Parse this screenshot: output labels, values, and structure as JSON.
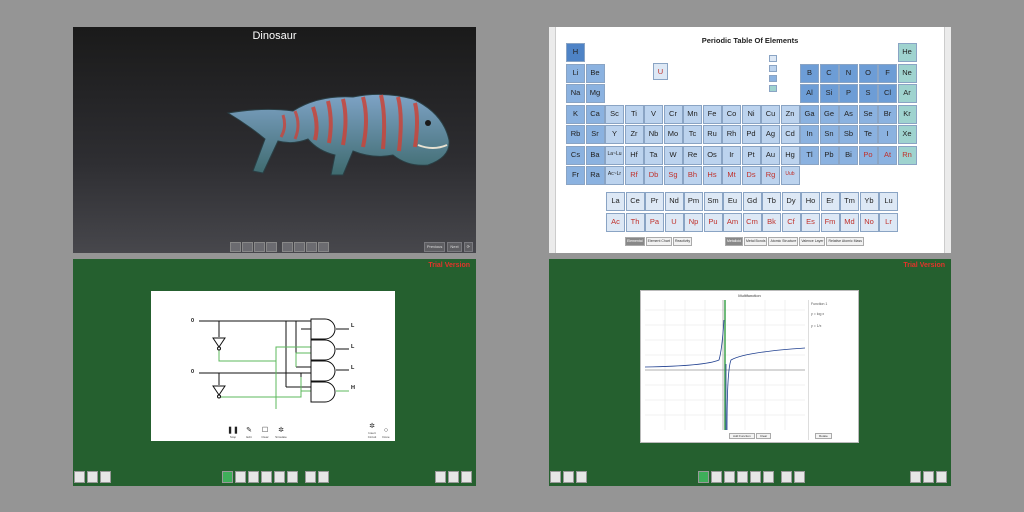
{
  "dinosaur": {
    "title": "Dinosaur",
    "toolbar_icons": [
      "pointer-icon",
      "pen-icon",
      "eraser-icon",
      "fill-icon",
      "move-icon",
      "rotate-icon",
      "zoom-icon",
      "settings-icon"
    ],
    "right_buttons": [
      "Previous",
      "Next"
    ]
  },
  "periodic_table": {
    "title": "Periodic Table Of Elements",
    "featured": "U",
    "main_rows": [
      [
        "H",
        "",
        "",
        "",
        "",
        "",
        "",
        "",
        "",
        "",
        "",
        "",
        "",
        "",
        "",
        "",
        "",
        "He"
      ],
      [
        "Li",
        "Be",
        "",
        "",
        "",
        "",
        "",
        "",
        "",
        "",
        "",
        "",
        "B",
        "C",
        "N",
        "O",
        "F",
        "Ne"
      ],
      [
        "Na",
        "Mg",
        "",
        "",
        "",
        "",
        "",
        "",
        "",
        "",
        "",
        "",
        "Al",
        "Si",
        "P",
        "S",
        "Cl",
        "Ar"
      ],
      [
        "K",
        "Ca",
        "Sc",
        "Ti",
        "V",
        "Cr",
        "Mn",
        "Fe",
        "Co",
        "Ni",
        "Cu",
        "Zn",
        "Ga",
        "Ge",
        "As",
        "Se",
        "Br",
        "Kr"
      ],
      [
        "Rb",
        "Sr",
        "Y",
        "Zr",
        "Nb",
        "Mo",
        "Tc",
        "Ru",
        "Rh",
        "Pd",
        "Ag",
        "Cd",
        "In",
        "Sn",
        "Sb",
        "Te",
        "I",
        "Xe"
      ],
      [
        "Cs",
        "Ba",
        "La~Lu",
        "Hf",
        "Ta",
        "W",
        "Re",
        "Os",
        "Ir",
        "Pt",
        "Au",
        "Hg",
        "Tl",
        "Pb",
        "Bi",
        "Po",
        "At",
        "Rn"
      ],
      [
        "Fr",
        "Ra",
        "Ac~Lr",
        "Rf",
        "Db",
        "Sg",
        "Bh",
        "Hs",
        "Mt",
        "Ds",
        "Rg",
        "Uub",
        "",
        "",
        "",
        "",
        "",
        ""
      ]
    ],
    "lanthanides": [
      "La",
      "Ce",
      "Pr",
      "Nd",
      "Pm",
      "Sm",
      "Eu",
      "Gd",
      "Tb",
      "Dy",
      "Ho",
      "Er",
      "Tm",
      "Yb",
      "Lu"
    ],
    "actinides": [
      "Ac",
      "Th",
      "Pa",
      "U",
      "Np",
      "Pu",
      "Am",
      "Cm",
      "Bk",
      "Cf",
      "Es",
      "Fm",
      "Md",
      "No",
      "Lr"
    ],
    "red_symbols": [
      "U",
      "Rf",
      "Db",
      "Sg",
      "Bh",
      "Hs",
      "Mt",
      "Ds",
      "Rg",
      "Uub",
      "Po",
      "At",
      "Rn",
      "Ac",
      "Th",
      "Pa",
      "Np",
      "Pu",
      "Am",
      "Cm",
      "Bk",
      "Cf",
      "Es",
      "Fm",
      "Md",
      "No",
      "Lr"
    ],
    "bottom_buttons_left": [
      "Elemental",
      "Element Chart",
      "Reactivity"
    ],
    "bottom_buttons_right": [
      "Metalloid",
      "Metal Bonds",
      "Atomic Structure",
      "Valence Layer",
      "Relative Atomic Mass"
    ]
  },
  "logic_circuit": {
    "trial_label": "Trial Version",
    "inputs": [
      "0",
      "0"
    ],
    "outputs": [
      "L",
      "L",
      "L",
      "H"
    ],
    "controls": [
      {
        "glyph": "❚❚",
        "label": "Stop"
      },
      {
        "glyph": "✎",
        "label": "Edit"
      },
      {
        "glyph": "☐",
        "label": "Clear"
      },
      {
        "glyph": "✲",
        "label": "Simulate"
      }
    ],
    "right_controls": [
      {
        "glyph": "✲",
        "label": "Insert Circuit"
      },
      {
        "glyph": "○",
        "label": "Done"
      }
    ]
  },
  "function_graph": {
    "trial_label": "Trial Version",
    "window_title": "Multifunction",
    "side_items": [
      "Function 1",
      "y = log x",
      "y = 1/x"
    ],
    "bottom_buttons": [
      "Add Function",
      "Clear"
    ],
    "side_button": "Rotate"
  }
}
